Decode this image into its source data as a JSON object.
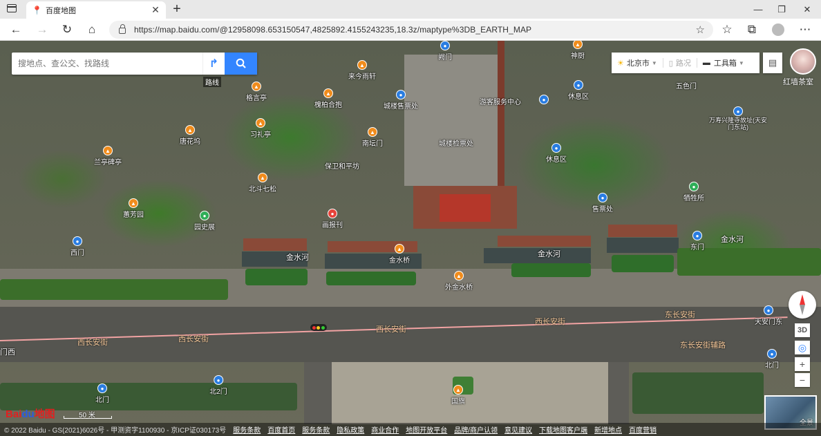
{
  "browser": {
    "tab_title": "百度地图",
    "url": "https://map.baidu.com/@12958098.653150547,4825892.4155243235,18.3z/maptype%3DB_EARTH_MAP"
  },
  "search": {
    "placeholder": "搜地点、查公交、找路线",
    "route_tip": "路线"
  },
  "toolbar": {
    "city": "北京市",
    "route": "路况",
    "tools": "工具箱"
  },
  "avatar_label": "红墙茶室",
  "pois": [
    {
      "label": "神厨",
      "color": "orange"
    },
    {
      "label": "来今雨轩",
      "color": "orange"
    },
    {
      "label": "阙门",
      "color": "blue"
    },
    {
      "label": "格言亭",
      "color": "orange"
    },
    {
      "label": "槐柏合抱",
      "color": "orange"
    },
    {
      "label": "城楼售票处",
      "color": "blue"
    },
    {
      "label": "游客服务中心",
      "color": "blue"
    },
    {
      "label": "休息区",
      "color": "blue"
    },
    {
      "label": "五色门",
      "color": "greenp"
    },
    {
      "label": "万寿兴隆寺故址(天安门东站)",
      "color": "blue"
    },
    {
      "label": "唐花坞",
      "color": "orange"
    },
    {
      "label": "习礼亭",
      "color": "orange"
    },
    {
      "label": "南坛门",
      "color": "orange"
    },
    {
      "label": "城楼检票处",
      "color": "blue"
    },
    {
      "label": "兰亭碑亭",
      "color": "orange"
    },
    {
      "label": "休息区",
      "color": "blue"
    },
    {
      "label": "保卫和平坊",
      "color": "orange"
    },
    {
      "label": "北斗七松",
      "color": "orange"
    },
    {
      "label": "售票处",
      "color": "blue"
    },
    {
      "label": "牺牲所",
      "color": "greenp"
    },
    {
      "label": "蕙芳园",
      "color": "orange"
    },
    {
      "label": "园史展",
      "color": "greenp"
    },
    {
      "label": "画报刊",
      "color": "red"
    },
    {
      "label": "西门",
      "color": "blue"
    },
    {
      "label": "金水桥",
      "color": "orange"
    },
    {
      "label": "外金水桥",
      "color": "orange"
    },
    {
      "label": "东门",
      "color": "blue"
    },
    {
      "label": "天安门东",
      "color": "blue"
    },
    {
      "label": "北门",
      "color": "blue"
    },
    {
      "label": "北2门",
      "color": "blue"
    },
    {
      "label": "北门",
      "color": "blue"
    },
    {
      "label": "国旗",
      "color": "orange"
    }
  ],
  "road_labels": [
    "金水河",
    "金水河",
    "金水河",
    "西长安街",
    "西长安街",
    "西长安街",
    "西长安街",
    "东长安街",
    "东长安街辅路",
    "门西"
  ],
  "controls": {
    "d3": "3D",
    "zoom_in": "+",
    "zoom_out": "−",
    "thumb_label": "全景"
  },
  "scale_label": "50 米",
  "logo": {
    "bai": "Bai",
    "du": "du",
    "suffix": "地图"
  },
  "footer": {
    "copyright": "© 2022 Baidu - GS(2021)6026号 - 甲测资字1100930 - 京ICP证030173号",
    "links": [
      "服务条款",
      "百度首页",
      "服务条款",
      "隐私政策",
      "商业合作",
      "地图开放平台",
      "品牌/商户认领",
      "意见建议",
      "下载地图客户端",
      "新增地点",
      "百度营销"
    ]
  },
  "colors": {
    "accent": "#3385ff",
    "poi_orange": "#f08c1c",
    "poi_blue": "#2a7de1"
  }
}
